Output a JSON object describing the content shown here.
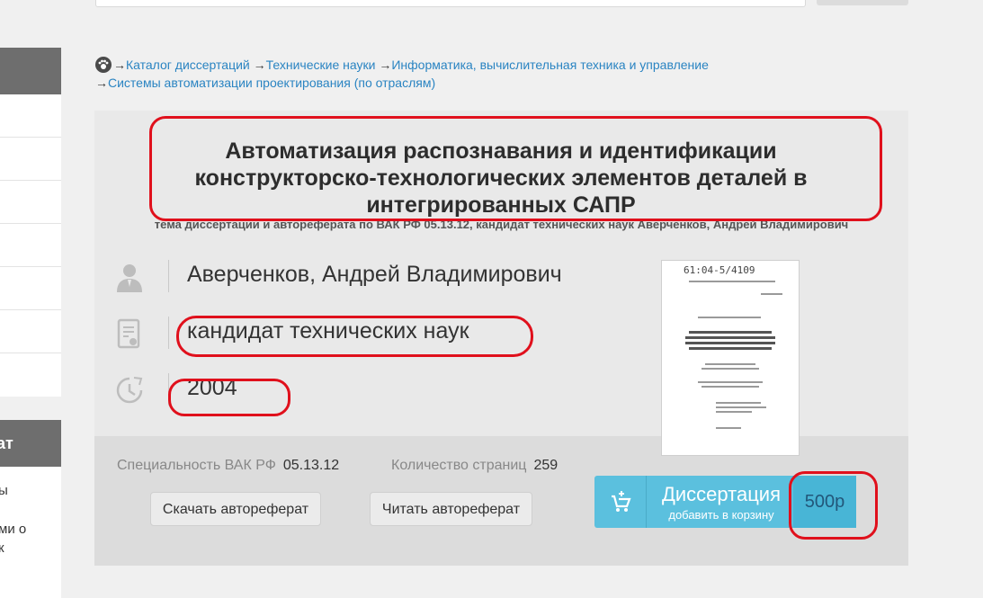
{
  "breadcrumb": {
    "items": [
      "Каталог диссертаций",
      "Технические науки",
      "Информатика, вычислительная техника и управление",
      "Системы автоматизации проектирования (по отраслям)"
    ],
    "arrow": "→"
  },
  "dissertation": {
    "title": "Автоматизация распознавания и идентификации конструкторско-технологических элементов деталей в интегрированных САПР",
    "subtitle": "тема диссертации и автореферата по ВАК РФ 05.13.12, кандидат технических наук Аверченков, Андрей Владимирович",
    "author": "Аверченков, Андрей Владимирович",
    "degree": "кандидат технических наук",
    "year": "2004",
    "thumbnail_handwriting": "61:04-5/4109"
  },
  "meta": {
    "specialty_label": "Специальность ВАК РФ",
    "specialty_value": "05.13.12",
    "pages_label": "Количество страниц",
    "pages_value": "259"
  },
  "buttons": {
    "download_abstract": "Скачать автореферат",
    "read_abstract": "Читать автореферат",
    "buy_title": "Диссертация",
    "buy_subtitle": "добавить в корзину",
    "price": "500р"
  },
  "sidebar": {
    "header_fragment": "ат",
    "line1": "ы",
    "line2": "ми о",
    "line3": "к"
  },
  "icons": {
    "author": "person-icon",
    "degree": "certificate-icon",
    "year": "clock-icon",
    "cart": "cart-icon",
    "home": "paw-icon"
  },
  "colors": {
    "link": "#2a84c2",
    "buy_button": "#5bc0de",
    "annotation": "#e0101c"
  }
}
